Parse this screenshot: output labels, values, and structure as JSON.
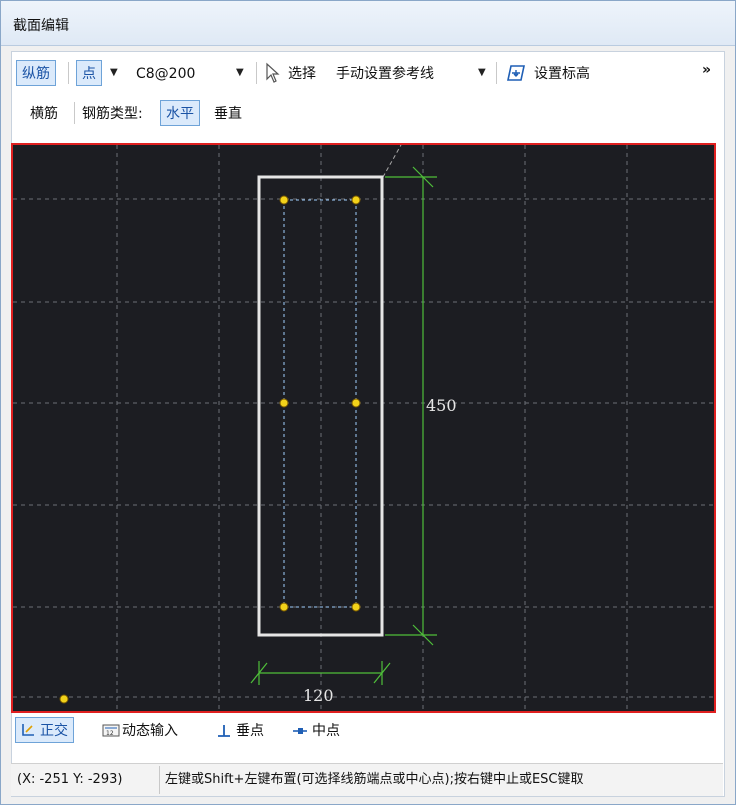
{
  "window": {
    "title": "截面编辑"
  },
  "toolbar": {
    "longitudinal": "纵筋",
    "point": "点",
    "spec_value": "C8@200",
    "select": "选择",
    "reference_line": "手动设置参考线",
    "set_elevation": "设置标高",
    "more": "»"
  },
  "toolbar2": {
    "stirrup": "横筋",
    "rebar_type_label": "钢筋类型:",
    "horizontal": "水平",
    "vertical": "垂直"
  },
  "drawing": {
    "height_dim": "450",
    "width_dim": "120",
    "accent_rebar": "#f2d21a",
    "accent_dim": "#4fbf3a"
  },
  "snap": {
    "orthogonal": "正交",
    "dynamic_input": "动态输入",
    "perpendicular": "垂点",
    "midpoint": "中点"
  },
  "status": {
    "coords": "(X: -251 Y: -293)",
    "hint": "左键或Shift+左键布置(可选择线筋端点或中心点);按右键中止或ESC键取"
  }
}
